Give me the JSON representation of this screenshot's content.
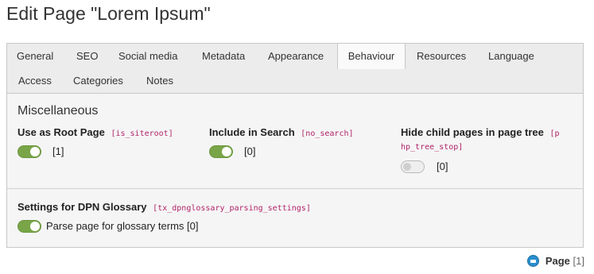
{
  "page": {
    "title": "Edit Page \"Lorem Ipsum\""
  },
  "tabs": [
    {
      "label": "General"
    },
    {
      "label": "SEO"
    },
    {
      "label": "Social media"
    },
    {
      "label": "Metadata"
    },
    {
      "label": "Appearance"
    },
    {
      "label": "Behaviour",
      "active": true
    },
    {
      "label": "Resources"
    },
    {
      "label": "Language"
    },
    {
      "label": "Access"
    },
    {
      "label": "Categories"
    },
    {
      "label": "Notes"
    }
  ],
  "misc": {
    "title": "Miscellaneous",
    "fields": [
      {
        "label": "Use as Root Page",
        "key": "[is_siteroot]",
        "on": true,
        "value": "[1]"
      },
      {
        "label": "Include in Search",
        "key": "[no_search]",
        "on": true,
        "value": "[0]"
      },
      {
        "label": "Hide child pages in page tree",
        "key_line1": "[p",
        "key_line2": "hp_tree_stop]",
        "on": false,
        "value": "[0]"
      }
    ]
  },
  "glossary": {
    "label": "Settings for DPN Glossary",
    "key": "[tx_dpnglossary_parsing_settings]",
    "toggle_on": true,
    "toggle_label": "Parse page for glossary terms [0]"
  },
  "footer": {
    "label": "Page",
    "uid": "[1]",
    "icon": "page-icon"
  },
  "colors": {
    "toggle_on": "#79a548",
    "field_key": "#b0256a",
    "panel_bg": "#f5f5f5",
    "tabs_bg": "#ececec"
  }
}
